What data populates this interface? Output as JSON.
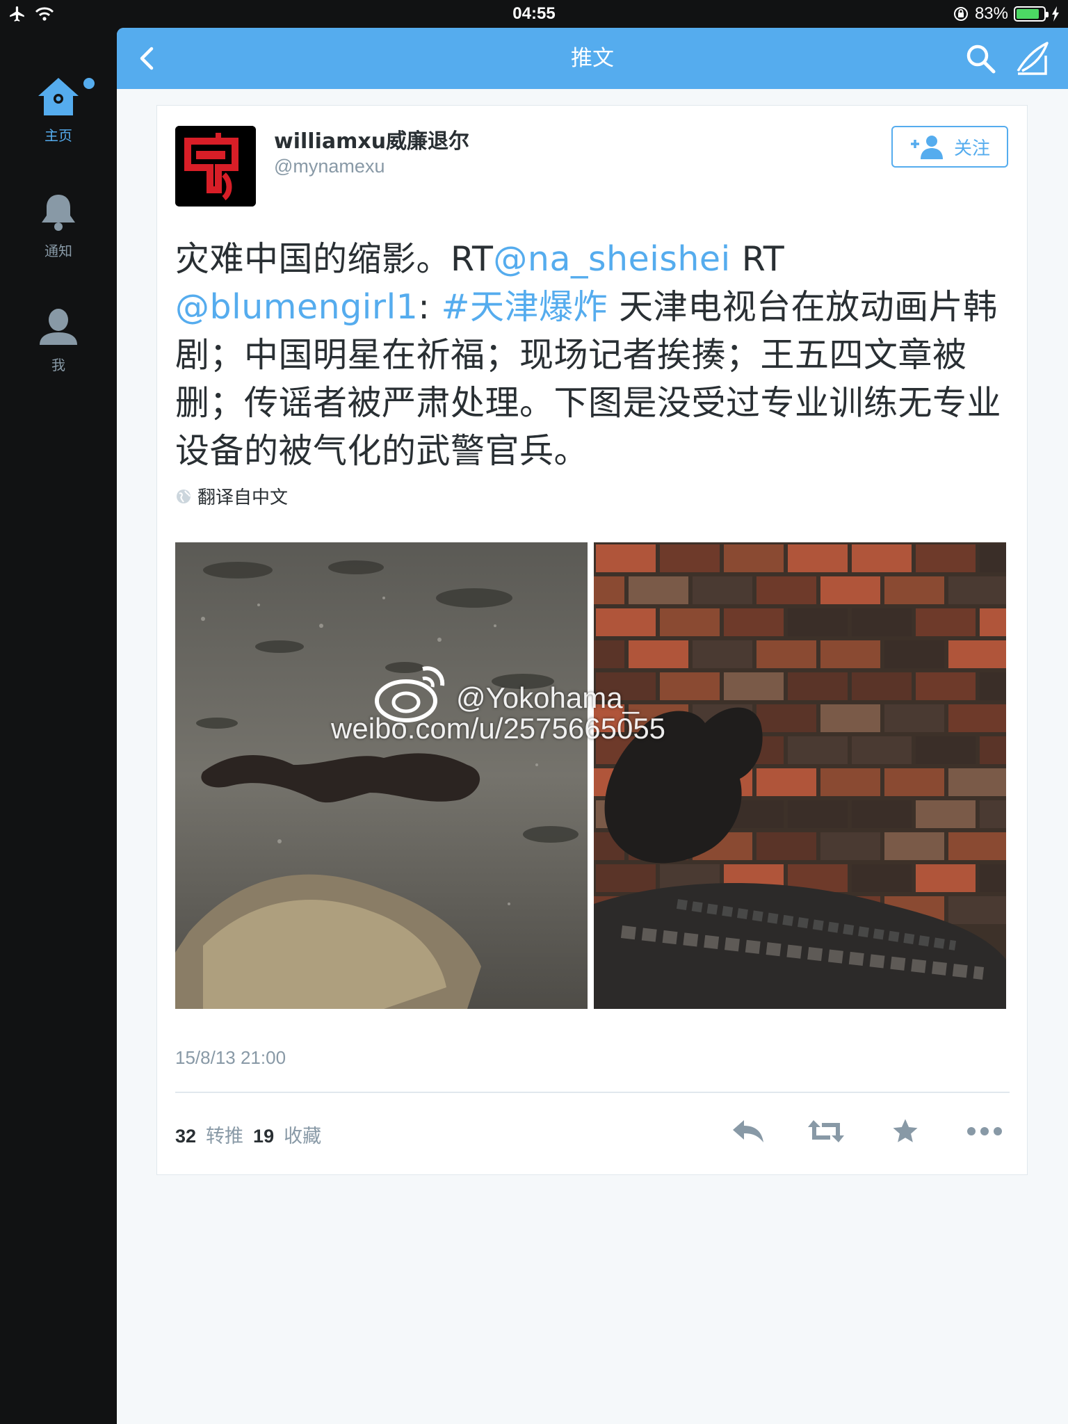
{
  "status_bar": {
    "time": "04:55",
    "battery_text": "83%",
    "battery_level": 0.83
  },
  "sidebar": {
    "items": [
      {
        "label": "主页",
        "icon": "home-icon",
        "active": true
      },
      {
        "label": "通知",
        "icon": "bell-icon",
        "active": false
      },
      {
        "label": "我",
        "icon": "person-icon",
        "active": false
      }
    ]
  },
  "nav": {
    "title": "推文",
    "back_icon": "back-chevron-icon",
    "search_icon": "search-icon",
    "compose_icon": "compose-icon"
  },
  "tweet": {
    "display_name": "williamxu威廉退尔",
    "handle": "@mynamexu",
    "follow_label": "关注",
    "text_segments": [
      {
        "text": "灾难中国的缩影。RT",
        "link": false
      },
      {
        "text": "@na_sheishei",
        "link": true
      },
      {
        "text": " RT ",
        "link": false
      },
      {
        "text": "@blumengirl1",
        "link": true
      },
      {
        "text": ": ",
        "link": false
      },
      {
        "text": "#天津爆炸",
        "link": true
      },
      {
        "text": " 天津电视台在放动画片韩剧；中国明星在祈福；现场记者挨揍；王五四文章被删；传谣者被严肃处理。下图是没受过专业训练无专业设备的被气化的武警官兵。",
        "link": false
      }
    ],
    "translated_label": "翻译自中文",
    "watermark_handle": "@Yokohama_",
    "watermark_url": "weibo.com/u/2575665055",
    "timestamp": "15/8/13 21:00",
    "retweet_count": "32",
    "retweet_label": "转推",
    "favorite_count": "19",
    "favorite_label": "收藏"
  },
  "colors": {
    "accent": "#55acee",
    "sidebar_bg": "#111213",
    "panel_bg": "#f5f8fa",
    "text": "#292f33",
    "muted": "#8899a6"
  }
}
